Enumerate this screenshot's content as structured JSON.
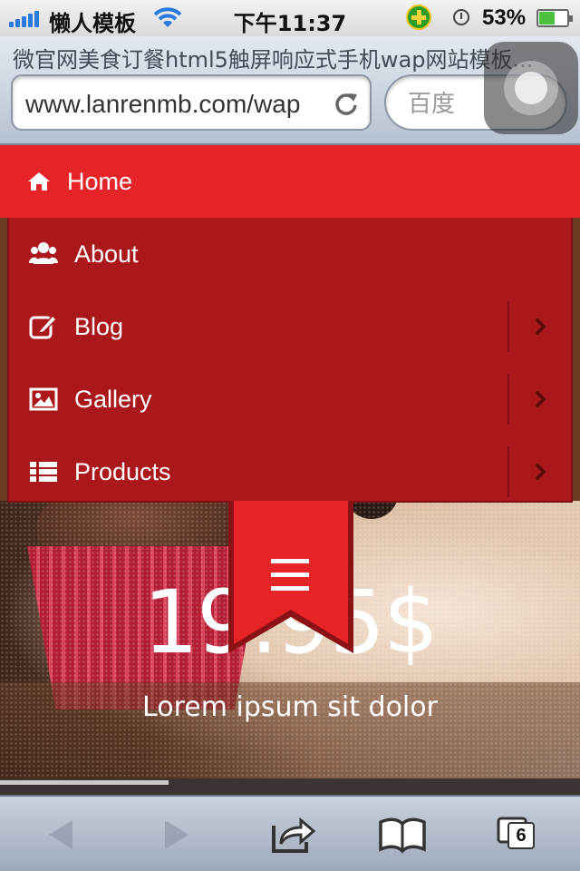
{
  "status_bar": {
    "carrier": "懒人模板",
    "time": "下午11:37",
    "battery": "53%"
  },
  "browser": {
    "page_title": "微官网美食订餐html5触屏响应式手机wap网站模板...",
    "url": "www.lanrenmb.com/wap",
    "search_placeholder": "百度",
    "tabs_count": "6"
  },
  "nav": {
    "home": "Home",
    "items": [
      {
        "label": "About",
        "icon": "users-icon",
        "has_submenu": false
      },
      {
        "label": "Blog",
        "icon": "edit-icon",
        "has_submenu": true
      },
      {
        "label": "Gallery",
        "icon": "image-icon",
        "has_submenu": true
      },
      {
        "label": "Products",
        "icon": "list-icon",
        "has_submenu": true
      }
    ]
  },
  "hero": {
    "price": "19.95$",
    "subtitle": "Lorem ipsum sit dolor",
    "slider_progress": 0.29
  },
  "colors": {
    "nav_active": "#e62326",
    "nav_bg": "#aa181b"
  }
}
